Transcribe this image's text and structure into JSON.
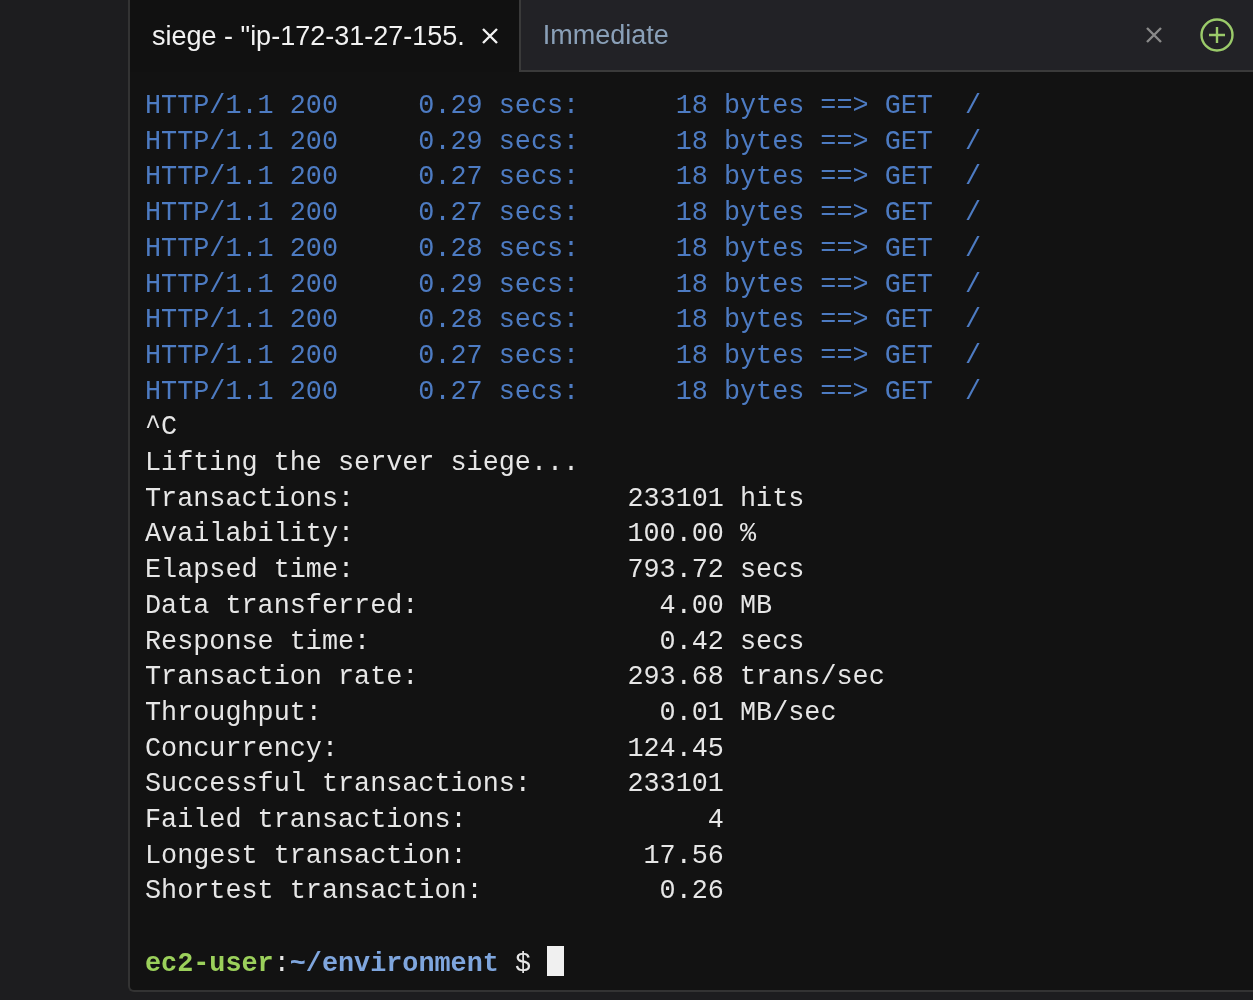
{
  "tabs": [
    {
      "label": "siege - \"ip-172-31-27-155.",
      "selected": true
    },
    {
      "label": "Immediate",
      "selected": false
    }
  ],
  "log_rows": [
    {
      "protocol": "HTTP/1.1 200",
      "time": "0.29 secs:",
      "size": "18 bytes",
      "arrow": "==>",
      "method": "GET",
      "path": "/"
    },
    {
      "protocol": "HTTP/1.1 200",
      "time": "0.29 secs:",
      "size": "18 bytes",
      "arrow": "==>",
      "method": "GET",
      "path": "/"
    },
    {
      "protocol": "HTTP/1.1 200",
      "time": "0.27 secs:",
      "size": "18 bytes",
      "arrow": "==>",
      "method": "GET",
      "path": "/"
    },
    {
      "protocol": "HTTP/1.1 200",
      "time": "0.27 secs:",
      "size": "18 bytes",
      "arrow": "==>",
      "method": "GET",
      "path": "/"
    },
    {
      "protocol": "HTTP/1.1 200",
      "time": "0.28 secs:",
      "size": "18 bytes",
      "arrow": "==>",
      "method": "GET",
      "path": "/"
    },
    {
      "protocol": "HTTP/1.1 200",
      "time": "0.29 secs:",
      "size": "18 bytes",
      "arrow": "==>",
      "method": "GET",
      "path": "/"
    },
    {
      "protocol": "HTTP/1.1 200",
      "time": "0.28 secs:",
      "size": "18 bytes",
      "arrow": "==>",
      "method": "GET",
      "path": "/"
    },
    {
      "protocol": "HTTP/1.1 200",
      "time": "0.27 secs:",
      "size": "18 bytes",
      "arrow": "==>",
      "method": "GET",
      "path": "/"
    },
    {
      "protocol": "HTTP/1.1 200",
      "time": "0.27 secs:",
      "size": "18 bytes",
      "arrow": "==>",
      "method": "GET",
      "path": "/"
    }
  ],
  "messages": [
    "^C",
    "Lifting the server siege..."
  ],
  "summary": [
    {
      "label": "Transactions:",
      "value": "233101",
      "unit": "hits"
    },
    {
      "label": "Availability:",
      "value": "100.00",
      "unit": "%"
    },
    {
      "label": "Elapsed time:",
      "value": "793.72",
      "unit": "secs"
    },
    {
      "label": "Data transferred:",
      "value": "4.00",
      "unit": "MB"
    },
    {
      "label": "Response time:",
      "value": "0.42",
      "unit": "secs"
    },
    {
      "label": "Transaction rate:",
      "value": "293.68",
      "unit": "trans/sec"
    },
    {
      "label": "Throughput:",
      "value": "0.01",
      "unit": "MB/sec"
    },
    {
      "label": "Concurrency:",
      "value": "124.45"
    },
    {
      "label": "Successful transactions:",
      "value": "233101"
    },
    {
      "label": "Failed transactions:",
      "value": "4"
    },
    {
      "label": "Longest transaction:",
      "value": "17.56"
    },
    {
      "label": "Shortest transaction:",
      "value": "0.26"
    }
  ],
  "prompt": {
    "user": "ec2-user",
    "separator": ":",
    "path": "~/environment",
    "symbol": "$"
  }
}
